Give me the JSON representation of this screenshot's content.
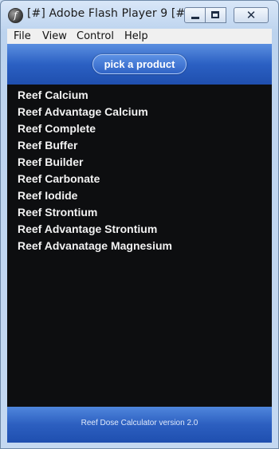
{
  "window": {
    "title": "[#] Adobe Flash Player 9 [#]",
    "app_icon_glyph": "f",
    "close_glyph": "✕"
  },
  "menu": {
    "items": [
      "File",
      "View",
      "Control",
      "Help"
    ]
  },
  "header": {
    "pick_label": "pick a product"
  },
  "products": [
    "Reef Calcium",
    "Reef Advantage Calcium",
    "Reef Complete",
    "Reef Buffer",
    "Reef Builder",
    "Reef Carbonate",
    "Reef Iodide",
    "Reef Strontium",
    "Reef Advantage Strontium",
    "Reef Advanatage Magnesium"
  ],
  "footer": {
    "version_text": "Reef Dose Calculator version 2.0"
  },
  "colors": {
    "stage_bg": "#0d0e10",
    "header_blue": "#2b60c3",
    "list_text": "#f2f2f2"
  }
}
